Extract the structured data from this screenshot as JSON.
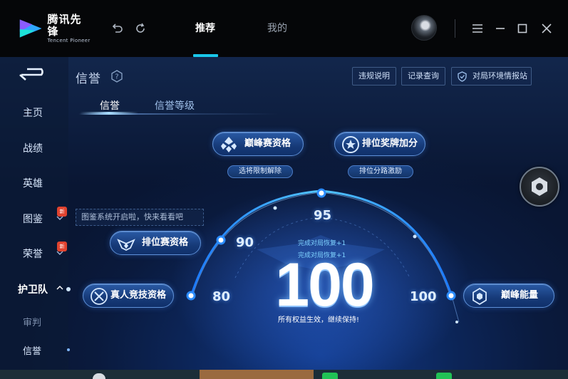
{
  "app": {
    "logo_cn": "腾讯先锋",
    "logo_en": "Tencent Pioneer",
    "tabs": [
      {
        "label": "推荐",
        "active": true
      },
      {
        "label": "我的",
        "active": false
      }
    ],
    "icons": [
      "undo-icon",
      "refresh-icon",
      "menu-icon",
      "minimize-icon",
      "maximize-icon",
      "close-icon"
    ]
  },
  "sidebar": {
    "items": [
      {
        "label": "主页"
      },
      {
        "label": "战绩"
      },
      {
        "label": "英雄"
      },
      {
        "label": "图鉴",
        "badge": "新"
      },
      {
        "label": "荣誉",
        "badge": "新"
      },
      {
        "label": "护卫队"
      },
      {
        "label": "审判"
      },
      {
        "label": "信誉"
      }
    ],
    "tooltip": "图鉴系统开启啦，快来看看吧"
  },
  "header": {
    "title": "信誉",
    "buttons": [
      "违规说明",
      "记录查询",
      "对局环境情报站"
    ]
  },
  "subtabs": [
    {
      "label": "信誉",
      "active": true
    },
    {
      "label": "信誉等级",
      "active": false
    }
  ],
  "perks": {
    "peak_match": "巅峰赛资格",
    "peak_match_sub": "选将限制解除",
    "rank_bonus": "排位奖牌加分",
    "rank_bonus_sub": "排位分路激励",
    "rank_match": "排位赛资格",
    "real_match": "真人竞技资格",
    "peak_energy": "巅峰能量"
  },
  "gauge": {
    "score": "100",
    "marks": [
      "80",
      "90",
      "95",
      "100"
    ],
    "recover_lines": [
      "完成对局恢复+1",
      "完成对局恢复+1"
    ],
    "status": "所有权益生效，继续保持!",
    "arc_fraction": 1.0
  },
  "colors": {
    "accent": "#19c7ea",
    "badge": "#e0432f",
    "pill": "#1a4488"
  }
}
